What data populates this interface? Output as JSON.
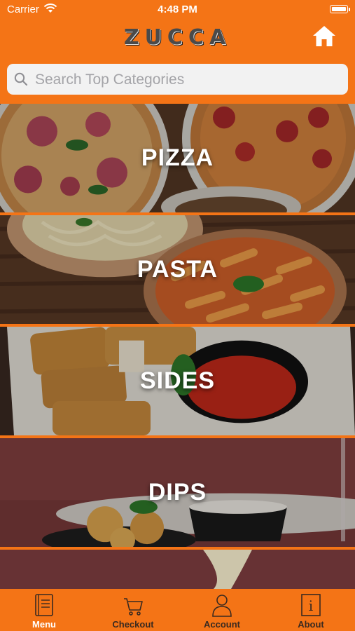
{
  "status_bar": {
    "carrier": "Carrier",
    "time": "4:48 PM"
  },
  "header": {
    "logo": "ZUCCA",
    "home_icon": "home-icon"
  },
  "search": {
    "placeholder": "Search Top Categories",
    "value": ""
  },
  "categories": [
    {
      "label": "PIZZA"
    },
    {
      "label": "PASTA"
    },
    {
      "label": "SIDES"
    },
    {
      "label": "DIPS"
    },
    {
      "label": ""
    }
  ],
  "tabs": [
    {
      "label": "Menu",
      "icon": "menu-book-icon",
      "active": true
    },
    {
      "label": "Checkout",
      "icon": "cart-icon",
      "active": false
    },
    {
      "label": "Account",
      "icon": "account-icon",
      "active": false
    },
    {
      "label": "About",
      "icon": "info-icon",
      "active": false
    }
  ],
  "colors": {
    "brand": "#f47416",
    "active_tab_text": "#ffffff",
    "tab_text": "#3a2a20"
  }
}
